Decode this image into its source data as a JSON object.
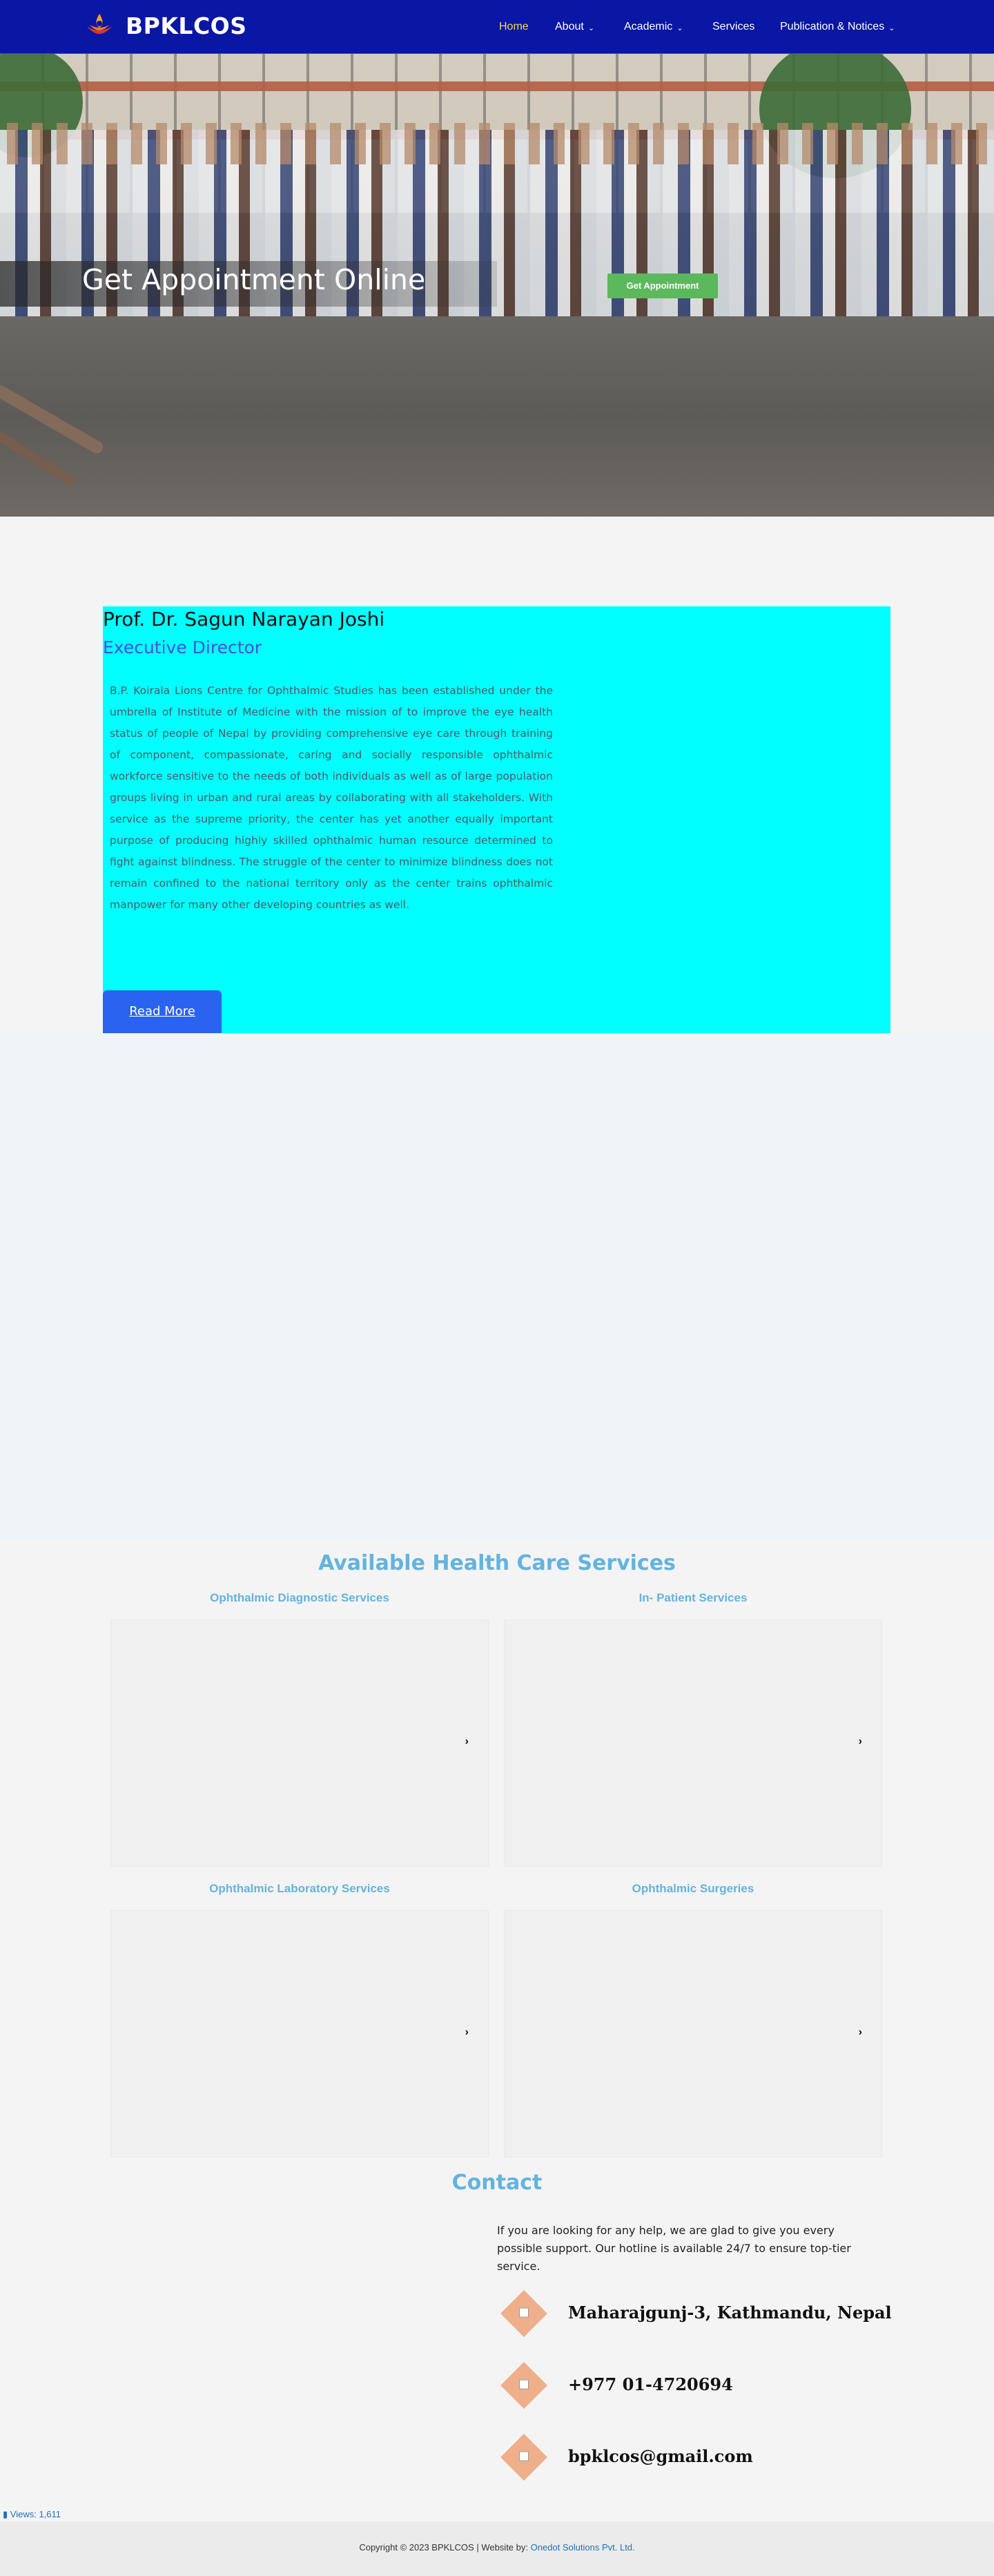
{
  "header": {
    "brand": "BPKLCOS",
    "nav": [
      {
        "label": "Home",
        "active": true
      },
      {
        "label": "About"
      },
      {
        "label": "Academic"
      },
      {
        "label": "Services"
      },
      {
        "label": "Publication & Notices"
      }
    ]
  },
  "hero": {
    "title": "Get Appointment Online",
    "button": "Get Appointment"
  },
  "director": {
    "name": "Prof. Dr. Sagun Narayan Joshi",
    "role": "Executive Director",
    "text": "B.P. Koirala Lions Centre for Ophthalmic Studies has been established under the umbrella of Institute of Medicine with the mission of to improve the eye health status of people of Nepal by providing comprehensive eye care through training of component, compassionate, caring and socially responsible ophthalmic workforce sensitive to the needs of both individuals as well as of large population groups living in urban and rural areas by collaborating with all stakeholders. With service as the supreme priority, the center has yet another equally important purpose of producing highly skilled ophthalmic human resource determined to fight against blindness. The struggle of the center to minimize blindness does not remain confined to the national territory only as the center trains ophthalmic manpower for many other developing countries as well.",
    "button": "Read More"
  },
  "services": {
    "title": "Available Health Care Services",
    "items": [
      {
        "label": "Ophthalmic Diagnostic Services"
      },
      {
        "label": "In- Patient Services"
      },
      {
        "label": "Ophthalmic Laboratory Services"
      },
      {
        "label": "Ophthalmic Surgeries"
      }
    ]
  },
  "contact": {
    "title": "Contact",
    "text": "If you are looking for any help, we are glad to give you every possible support. Our hotline is available 24/7 to ensure top-tier service.",
    "address": "Maharajgunj-3, Kathmandu, Nepal",
    "phone": "+977 01-4720694",
    "email": "bpklcos@gmail.com"
  },
  "views": "Views: 1,611",
  "footer": {
    "copyright": "Copyright © 2023 BPKLCOS | Website by: ",
    "credit": "Onedot Solutions Pvt. Ltd."
  },
  "colors": {
    "header": "#0a16a4",
    "director_bg": "#00ffff",
    "accent": "#63b3df",
    "appointment_button": "#5cb85c",
    "read_more": "#2a63f0"
  }
}
